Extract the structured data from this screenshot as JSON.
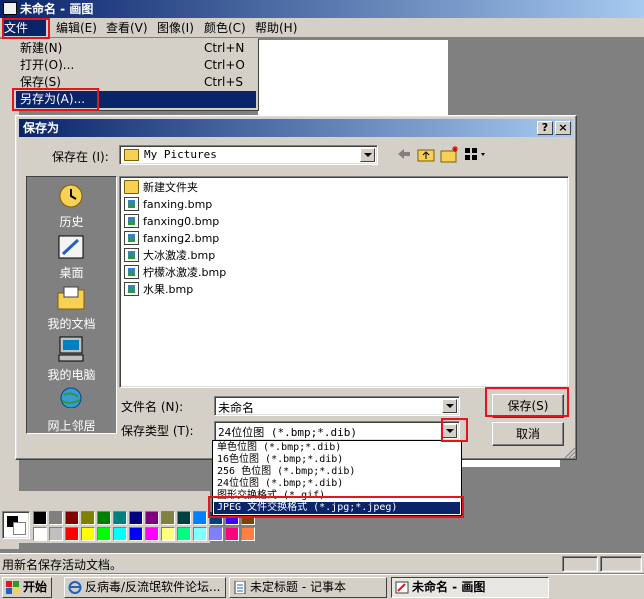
{
  "paint_window": {
    "title": "未命名 - 画图",
    "menus": [
      {
        "label": "文件(F)"
      },
      {
        "label": "编辑(E)"
      },
      {
        "label": "查看(V)"
      },
      {
        "label": "图像(I)"
      },
      {
        "label": "颜色(C)"
      },
      {
        "label": "帮助(H)"
      }
    ]
  },
  "file_menu": {
    "items": [
      {
        "label": "新建(N)",
        "shortcut": "Ctrl+N"
      },
      {
        "label": "打开(O)...",
        "shortcut": "Ctrl+O"
      },
      {
        "label": "保存(S)",
        "shortcut": "Ctrl+S"
      },
      {
        "label": "另存为(A)...",
        "shortcut": ""
      }
    ]
  },
  "dialog": {
    "title": "保存为",
    "help_glyph": "?",
    "close_glyph": "×",
    "save_in_label": "保存在 (I):",
    "save_in_value": "My Pictures",
    "places": [
      {
        "label": "历史",
        "icon": "history-icon"
      },
      {
        "label": "桌面",
        "icon": "desktop-icon"
      },
      {
        "label": "我的文档",
        "icon": "my-documents-icon"
      },
      {
        "label": "我的电脑",
        "icon": "my-computer-icon"
      },
      {
        "label": "网上邻居",
        "icon": "network-icon"
      }
    ],
    "files": [
      {
        "name": "新建文件夹",
        "type": "folder"
      },
      {
        "name": "fanxing.bmp",
        "type": "bmp"
      },
      {
        "name": "fanxing0.bmp",
        "type": "bmp"
      },
      {
        "name": "fanxing2.bmp",
        "type": "bmp"
      },
      {
        "name": "大冰激凌.bmp",
        "type": "bmp"
      },
      {
        "name": "柠檬冰激凌.bmp",
        "type": "bmp"
      },
      {
        "name": "水果.bmp",
        "type": "bmp"
      }
    ],
    "filename_label": "文件名 (N):",
    "filename_value": "未命名",
    "filetype_label": "保存类型 (T):",
    "filetype_value": "24位位图 (*.bmp;*.dib)",
    "save_button": "保存(S)",
    "cancel_button": "取消",
    "filetype_options": [
      "单色位图 (*.bmp;*.dib)",
      "16色位图 (*.bmp;*.dib)",
      "256 色位图 (*.bmp;*.dib)",
      "24位位图 (*.bmp;*.dib)",
      "图形交换格式 (*.gif)",
      "JPEG 文件交换格式 (*.jpg;*.jpeg)"
    ]
  },
  "status_bar": {
    "text": "用新名保存活动文档。"
  },
  "taskbar": {
    "start": "开始",
    "tasks": [
      {
        "label": "反病毒/反流氓软件论坛...",
        "icon": "ie-icon"
      },
      {
        "label": "未定标题 - 记事本",
        "icon": "notepad-icon"
      },
      {
        "label": "未命名 - 画图",
        "icon": "paint-icon"
      }
    ]
  },
  "colors": {
    "highlight": "#e8141c",
    "title_bar": "#0a246a",
    "palette": [
      "#000000",
      "#808080",
      "#800000",
      "#808000",
      "#008000",
      "#008080",
      "#000080",
      "#800080",
      "#808040",
      "#004040",
      "#0080ff",
      "#004080",
      "#4000ff",
      "#804000",
      "#ffffff",
      "#c0c0c0",
      "#ff0000",
      "#ffff00",
      "#00ff00",
      "#00ffff",
      "#0000ff",
      "#ff00ff",
      "#ffff80",
      "#00ff80",
      "#80ffff",
      "#8080ff",
      "#ff0080",
      "#ff8040"
    ]
  }
}
